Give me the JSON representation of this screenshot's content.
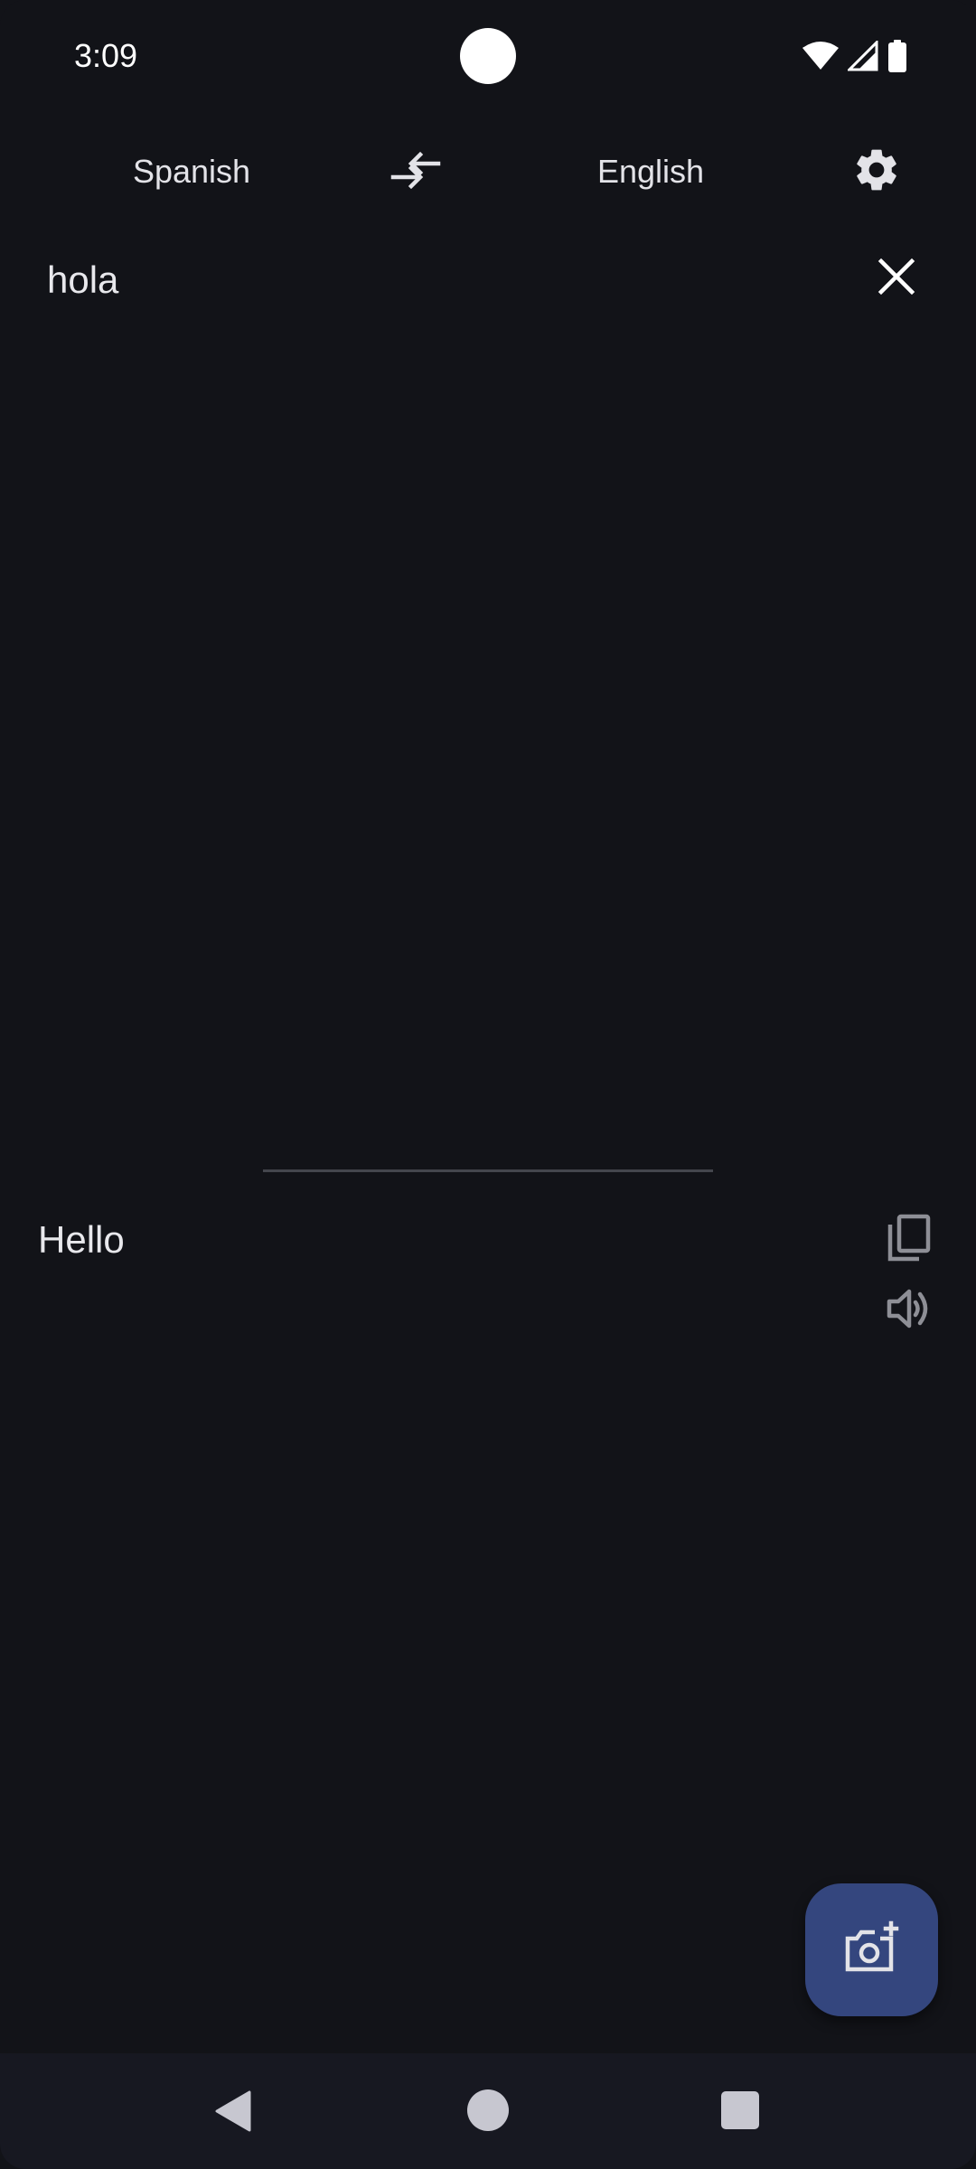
{
  "status_bar": {
    "time": "3:09",
    "icons": [
      "wifi-icon",
      "signal-icon",
      "battery-icon"
    ]
  },
  "language_bar": {
    "source_language": "Spanish",
    "target_language": "English",
    "swap_icon": "swap-arrows-icon",
    "settings_icon": "gear-icon"
  },
  "input": {
    "text": "hola",
    "clear_icon": "close-icon"
  },
  "output": {
    "text": "Hello",
    "copy_icon": "copy-icon",
    "speak_icon": "speaker-icon"
  },
  "fab": {
    "icon": "add-photo-camera-icon"
  },
  "nav_bar": {
    "icons": [
      "back-icon",
      "home-icon",
      "recents-icon"
    ]
  },
  "colors": {
    "background": "#121318",
    "fab": "#34467e",
    "nav_bar": "#171821",
    "text": "#e3e3e8",
    "icon_muted": "#8e8f96"
  }
}
